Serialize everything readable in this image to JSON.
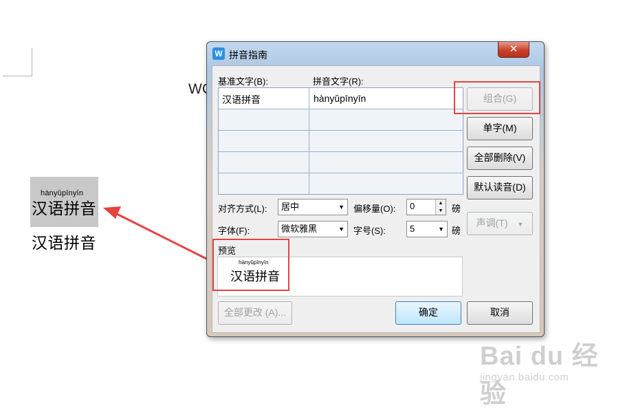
{
  "document": {
    "partial_text": "WC",
    "ruby_pinyin": "hànyǔpīnyīn",
    "ruby_text": "汉语拼音",
    "plain_text": "汉语拼音"
  },
  "dialog": {
    "title": "拼音指南",
    "app_icon_letter": "W",
    "close_symbol": "✕",
    "base_text_label": "基准文字(B):",
    "pinyin_text_label": "拼音文字(R):",
    "rows": [
      {
        "base": "汉语拼音",
        "pinyin": "hànyǔpīnyīn"
      },
      {
        "base": "",
        "pinyin": ""
      },
      {
        "base": "",
        "pinyin": ""
      },
      {
        "base": "",
        "pinyin": ""
      },
      {
        "base": "",
        "pinyin": ""
      }
    ],
    "buttons": {
      "group": "组合(G)",
      "single_char": "单字(M)",
      "clear_all": "全部删除(V)",
      "default_reading": "默认读音(D)",
      "tone": "声调(T)",
      "apply_all": "全部更改 (A)...",
      "ok": "确定",
      "cancel": "取消"
    },
    "alignment_label": "对齐方式(L):",
    "alignment_value": "居中",
    "offset_label": "偏移量(O):",
    "offset_value": "0",
    "offset_unit": "磅",
    "font_label": "字体(F):",
    "font_value": "微软雅黑",
    "size_label": "字号(S):",
    "size_value": "5",
    "size_unit": "磅",
    "preview_label": "预览",
    "preview_pinyin": "hànyǔpīnyīn",
    "preview_text": "汉语拼音"
  },
  "watermark": {
    "main": "Bai du 经验",
    "sub": "jingyan.baidu.com"
  },
  "colors": {
    "annotation_red": "#e8413f",
    "highlight_gray": "#c8c8c8"
  }
}
